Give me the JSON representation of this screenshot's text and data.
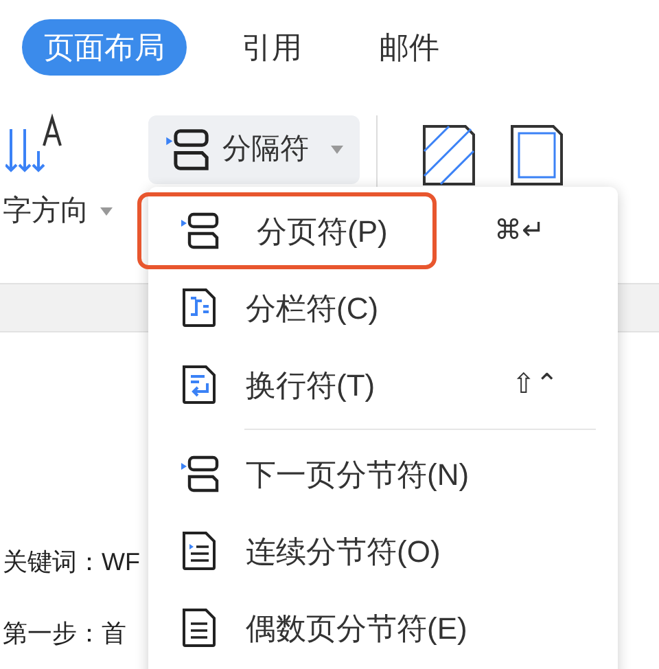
{
  "tabs": [
    {
      "label": "页面布局",
      "selected": true
    },
    {
      "label": "引用",
      "selected": false
    },
    {
      "label": "邮件",
      "selected": false
    }
  ],
  "ribbon": {
    "text_direction": {
      "label": "字方向"
    },
    "breaks_button": {
      "label": "分隔符",
      "pressed": true
    }
  },
  "document": {
    "lines": [
      "关键词：WF",
      "第一步：首"
    ]
  },
  "menu": {
    "items": [
      {
        "kind": "page",
        "label": "分页符(P)",
        "shortcut": "⌘↵",
        "selected": true
      },
      {
        "kind": "column",
        "label": "分栏符(C)",
        "selected": false
      },
      {
        "kind": "wrap",
        "label": "换行符(T)",
        "shortcut": "⇧⌃",
        "selected": false
      },
      {
        "kind": "separator"
      },
      {
        "kind": "page",
        "label": "下一页分节符(N)",
        "selected": false
      },
      {
        "kind": "continuous",
        "label": "连续分节符(O)",
        "selected": false
      },
      {
        "kind": "even",
        "label": "偶数页分节符(E)",
        "selected": false
      }
    ]
  }
}
